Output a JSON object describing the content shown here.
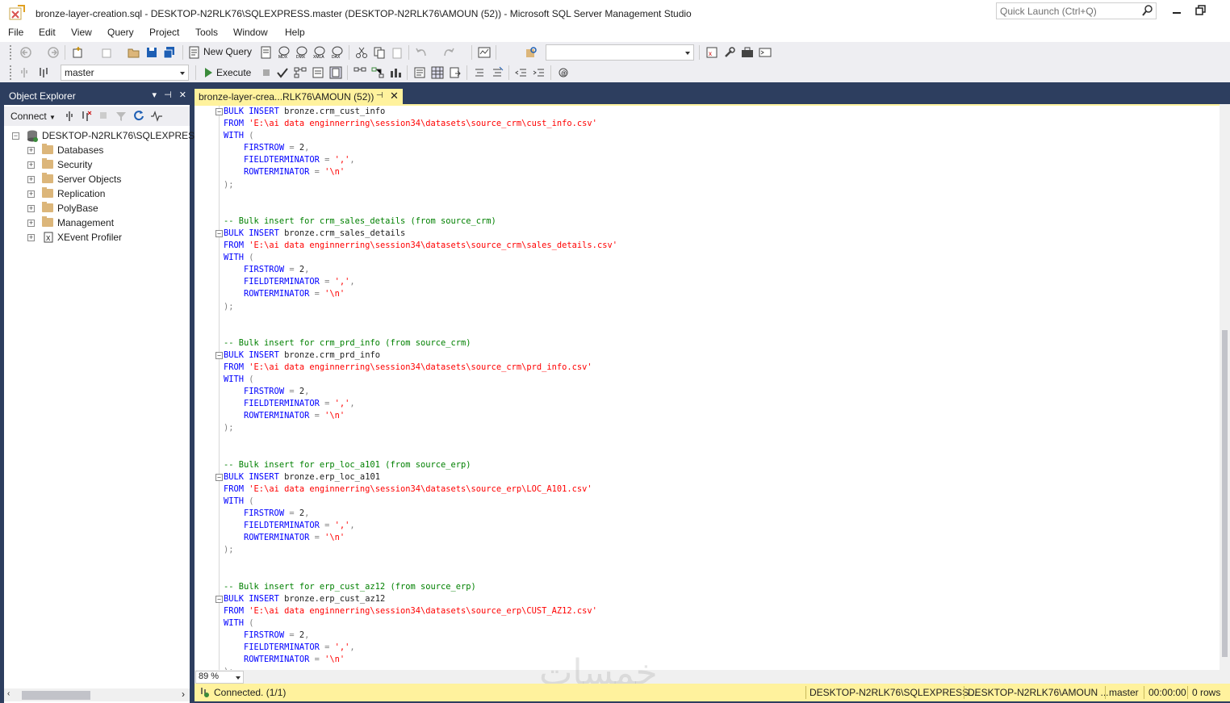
{
  "window": {
    "title": "bronze-layer-creation.sql - DESKTOP-N2RLK76\\SQLEXPRESS.master (DESKTOP-N2RLK76\\AMOUN (52)) - Microsoft SQL Server Management Studio",
    "quick_launch_placeholder": "Quick Launch (Ctrl+Q)"
  },
  "menu": [
    "File",
    "Edit",
    "View",
    "Query",
    "Project",
    "Tools",
    "Window",
    "Help"
  ],
  "toolbar": {
    "new_query_label": "New Query",
    "database_selected": "master",
    "execute_label": "Execute"
  },
  "object_explorer": {
    "title": "Object Explorer",
    "connect_label": "Connect",
    "server": "DESKTOP-N2RLK76\\SQLEXPRESS (S",
    "nodes": [
      "Databases",
      "Security",
      "Server Objects",
      "Replication",
      "PolyBase",
      "Management",
      "XEvent Profiler"
    ]
  },
  "document_tab": {
    "label": "bronze-layer-crea...RLK76\\AMOUN (52))"
  },
  "editor": {
    "zoom": "89 %",
    "blocks": [
      {
        "comment": "",
        "table": "bronze.crm_cust_info",
        "path": "'E:\\ai data enginnerring\\session34\\datasets\\source_crm\\cust_info.csv'"
      },
      {
        "comment": "-- Bulk insert for crm_sales_details (from source_crm)",
        "table": "bronze.crm_sales_details",
        "path": "'E:\\ai data enginnerring\\session34\\datasets\\source_crm\\sales_details.csv'"
      },
      {
        "comment": "-- Bulk insert for crm_prd_info (from source_crm)",
        "table": "bronze.crm_prd_info",
        "path": "'E:\\ai data enginnerring\\session34\\datasets\\source_crm\\prd_info.csv'"
      },
      {
        "comment": "-- Bulk insert for erp_loc_a101 (from source_erp)",
        "table": "bronze.erp_loc_a101",
        "path": "'E:\\ai data enginnerring\\session34\\datasets\\source_erp\\LOC_A101.csv'"
      },
      {
        "comment": "-- Bulk insert for erp_cust_az12 (from source_erp)",
        "table": "bronze.erp_cust_az12",
        "path": "'E:\\ai data enginnerring\\session34\\datasets\\source_erp\\CUST_AZ12.csv'"
      }
    ],
    "kw": {
      "bulk": "BULK",
      "insert": "INSERT",
      "from": "FROM",
      "with": "WITH",
      "firstrow": "FIRSTROW",
      "fieldterm": "FIELDTERMINATOR",
      "rowterm": "ROWTERMINATOR",
      "firstrow_val": "2",
      "fieldterm_val": "','",
      "rowterm_val": "'\\n'"
    }
  },
  "status": {
    "connected": "Connected. (1/1)",
    "server": "DESKTOP-N2RLK76\\SQLEXPRESS ...",
    "user": "DESKTOP-N2RLK76\\AMOUN ...",
    "database": "master",
    "elapsed": "00:00:00",
    "rows": "0 rows"
  },
  "watermark": "خمسات"
}
